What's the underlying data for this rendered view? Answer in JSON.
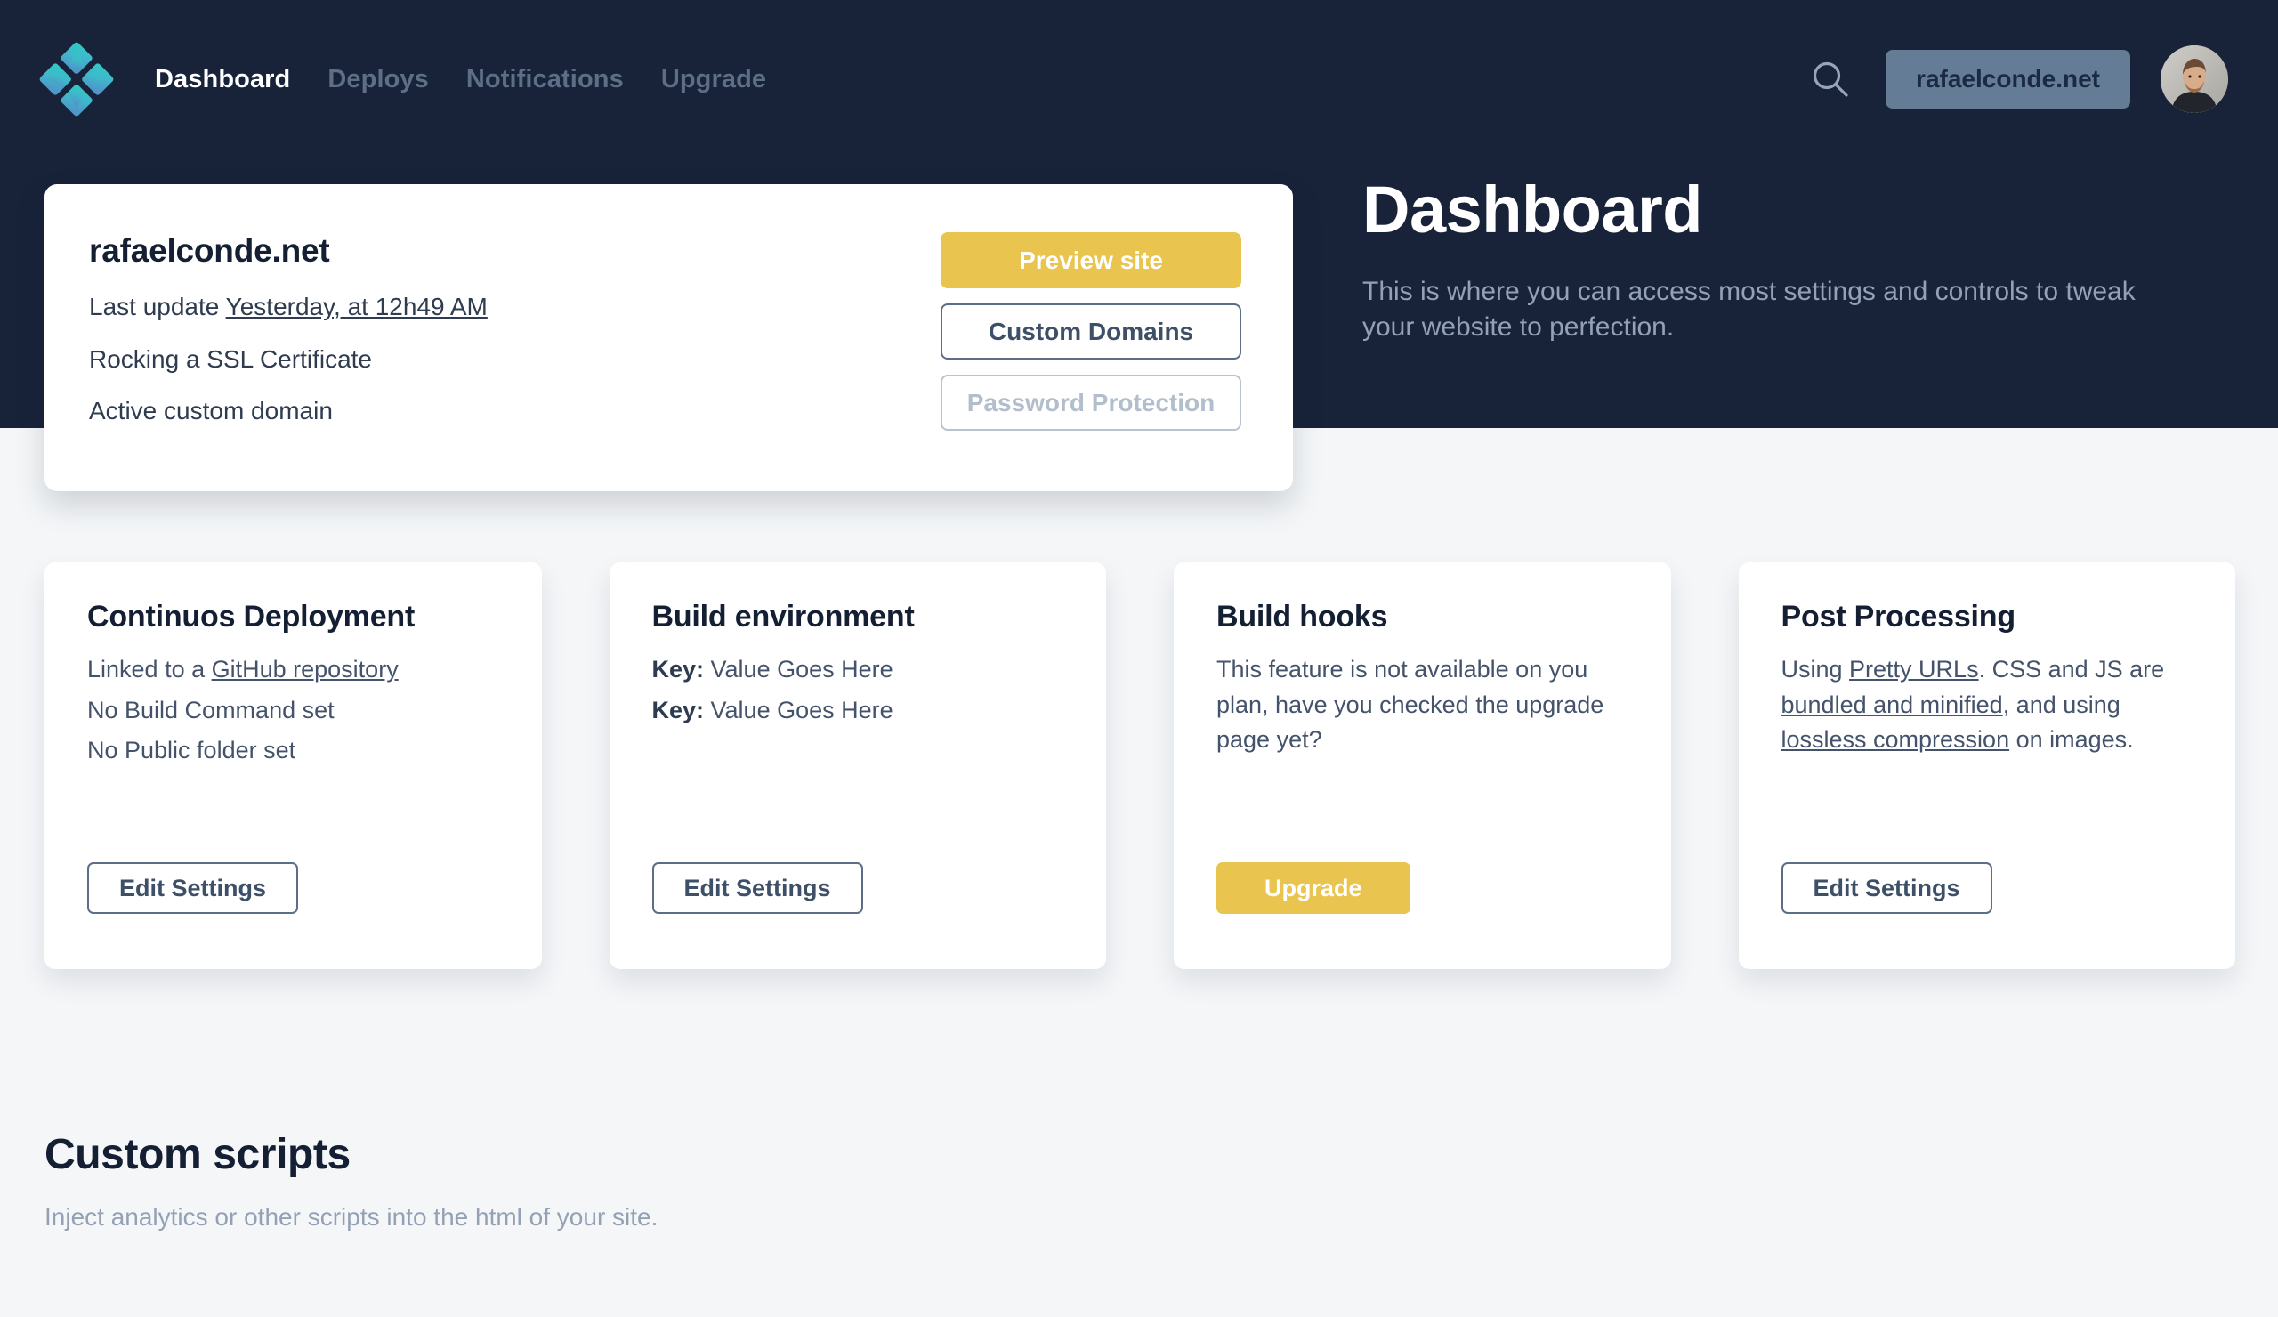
{
  "nav": {
    "logo_icon": "netlify-diamond-logo",
    "links": [
      {
        "label": "Dashboard",
        "active": true
      },
      {
        "label": "Deploys",
        "active": false
      },
      {
        "label": "Notifications",
        "active": false
      },
      {
        "label": "Upgrade",
        "active": false
      }
    ],
    "search_icon": "search-icon",
    "site_chip": "rafaelconde.net",
    "avatar_icon": "user-avatar-photo"
  },
  "hero": {
    "title": "Dashboard",
    "description": "This is where you can access most settings and controls to tweak your website to perfection."
  },
  "site_card": {
    "name": "rafaelconde.net",
    "last_update_prefix": "Last update ",
    "last_update_link": "Yesterday, at 12h49 AM",
    "ssl_line": "Rocking a SSL Certificate",
    "domain_line": "Active custom domain",
    "buttons": {
      "preview": "Preview site",
      "custom_domains": "Custom Domains",
      "password_protection": "Password Protection"
    }
  },
  "cards": [
    {
      "title": "Continuos Deployment",
      "lines": [
        {
          "before": "Linked to a ",
          "link": "GitHub repository",
          "after": ""
        },
        {
          "before": "No Build Command set",
          "link": "",
          "after": ""
        },
        {
          "before": "No Public folder set",
          "link": "",
          "after": ""
        }
      ],
      "button": {
        "label": "Edit Settings",
        "style": "outline"
      }
    },
    {
      "title": "Build environment",
      "kv": [
        {
          "key": "Key:",
          "value": " Value Goes Here"
        },
        {
          "key": "Key:",
          "value": " Value Goes Here"
        }
      ],
      "button": {
        "label": "Edit Settings",
        "style": "outline"
      }
    },
    {
      "title": "Build hooks",
      "text": "This feature is not available on you plan, have you checked the upgrade page yet?",
      "button": {
        "label": "Upgrade",
        "style": "yellow"
      }
    },
    {
      "title": "Post Processing",
      "rich": [
        {
          "t": "Using ",
          "u": false
        },
        {
          "t": "Pretty URLs",
          "u": true
        },
        {
          "t": ". CSS and JS are ",
          "u": false
        },
        {
          "t": "bundled and minified",
          "u": true
        },
        {
          "t": ", and using ",
          "u": false
        },
        {
          "t": "lossless compression",
          "u": true
        },
        {
          "t": " on images.",
          "u": false
        }
      ],
      "button": {
        "label": "Edit Settings",
        "style": "outline"
      }
    }
  ],
  "scripts": {
    "title": "Custom scripts",
    "subtitle": "Inject analytics or other scripts into the html of your site."
  },
  "colors": {
    "hero_bg": "#18233A",
    "page_bg": "#F4F6F8",
    "accent_yellow": "#E9C44E",
    "outline_blue": "#5C6E87",
    "chip_bg": "#647C96",
    "muted_text": "#94A1B4",
    "heading": "#141F34"
  }
}
